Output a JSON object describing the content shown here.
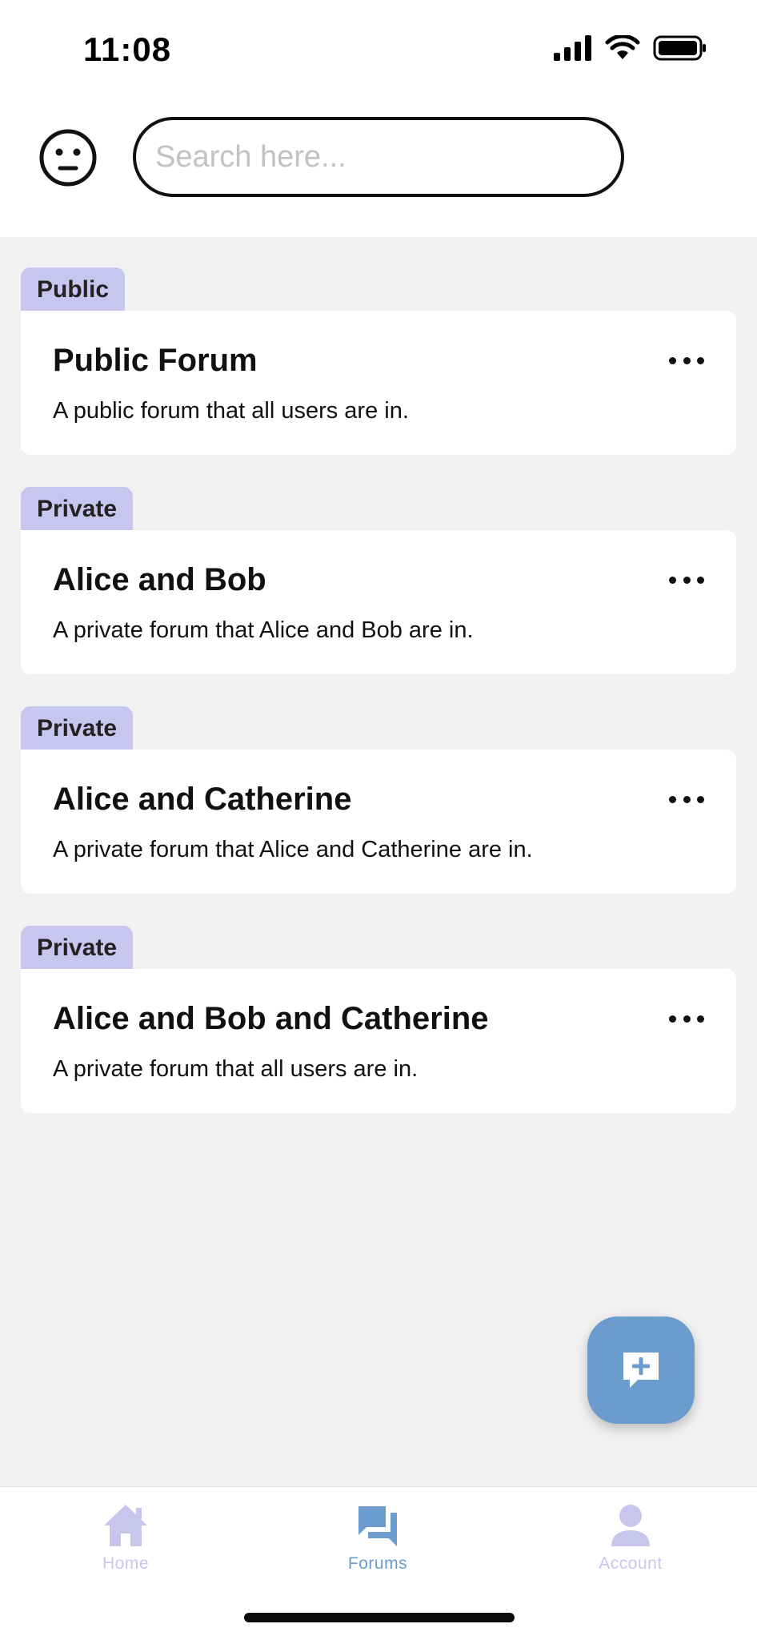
{
  "status_bar": {
    "time": "11:08",
    "icons": [
      "signal-icon",
      "wifi-icon",
      "battery-icon"
    ]
  },
  "header": {
    "avatar_icon": "neutral-face-icon",
    "search": {
      "placeholder": "Search here...",
      "value": ""
    }
  },
  "forums": [
    {
      "tag": "Public",
      "title": "Public Forum",
      "description": "A public forum that all users are in."
    },
    {
      "tag": "Private",
      "title": "Alice and Bob",
      "description": "A private forum that Alice and Bob are in."
    },
    {
      "tag": "Private",
      "title": "Alice and Catherine",
      "description": "A private forum that Alice and Catherine are in."
    },
    {
      "tag": "Private",
      "title": "Alice and Bob and Catherine",
      "description": "A private forum that all users are in."
    }
  ],
  "fab": {
    "icon": "add-comment-icon"
  },
  "bottom_nav": {
    "items": [
      {
        "label": "Home",
        "icon": "home-icon",
        "active": false
      },
      {
        "label": "Forums",
        "icon": "forum-icon",
        "active": true
      },
      {
        "label": "Account",
        "icon": "person-icon",
        "active": false
      }
    ]
  },
  "colors": {
    "tag_bg": "#c8c6ee",
    "accent": "#6b9ccd",
    "inactive_nav": "#c9c6ee",
    "background": "#f1f1f1",
    "card": "#ffffff"
  }
}
